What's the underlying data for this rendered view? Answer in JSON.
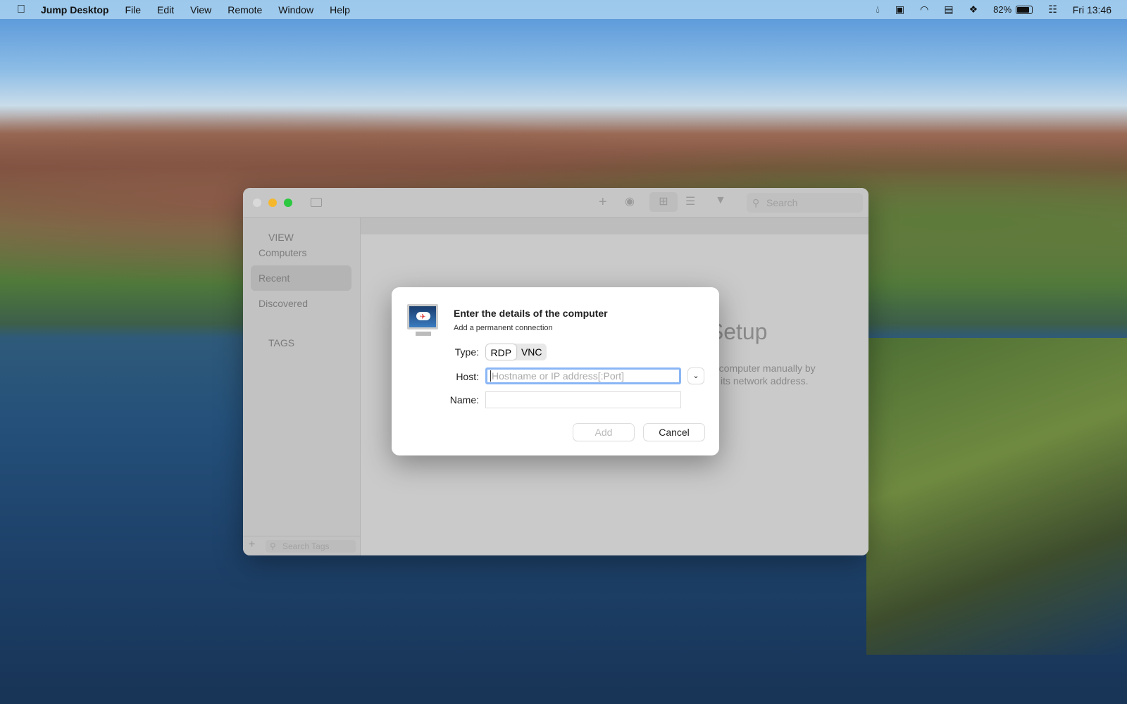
{
  "menubar": {
    "app": "Jump Desktop",
    "items": [
      "File",
      "Edit",
      "View",
      "Remote",
      "Window",
      "Help"
    ],
    "battery": "82%",
    "clock": "Fri 13:46"
  },
  "window": {
    "search_placeholder": "Search",
    "sidebar": {
      "view_header": "VIEW",
      "items": [
        "Computers",
        "Recent",
        "Discovered"
      ],
      "selected": "Recent",
      "tags_header": "TAGS",
      "search_tags_placeholder": "Search Tags"
    },
    "main": {
      "title": "Manual Setup",
      "desc_line1": "a computer manually by",
      "desc_line2": "its network address."
    }
  },
  "dialog": {
    "title": "Enter the details of the computer",
    "subtitle": "Add a permanent connection",
    "type_label": "Type:",
    "types": [
      "RDP",
      "VNC"
    ],
    "selected_type": "RDP",
    "host_label": "Host:",
    "host_placeholder": "Hostname or IP address[:Port]",
    "host_value": "",
    "name_label": "Name:",
    "name_value": "",
    "add": "Add",
    "cancel": "Cancel"
  },
  "colors": {
    "accent": "#4a8ff0",
    "close": "#d9d9d9",
    "minimize": "#f5b72c",
    "zoom": "#2bc840"
  }
}
